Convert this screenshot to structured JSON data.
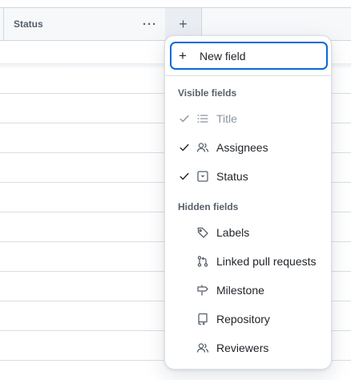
{
  "table": {
    "column": {
      "title": "Status",
      "menu_icon": "kebab-horizontal-icon"
    },
    "add_column_icon": "plus-icon"
  },
  "menu": {
    "new_field": {
      "label": "New field",
      "icon": "plus-icon"
    },
    "visible_section": "Visible fields",
    "hidden_section": "Hidden fields",
    "visible_items": [
      {
        "label": "Title",
        "icon": "list-icon",
        "checked": true,
        "disabled": true
      },
      {
        "label": "Assignees",
        "icon": "people-icon",
        "checked": true,
        "disabled": false
      },
      {
        "label": "Status",
        "icon": "single-select-icon",
        "checked": true,
        "disabled": false
      }
    ],
    "hidden_items": [
      {
        "label": "Labels",
        "icon": "tag-icon"
      },
      {
        "label": "Linked pull requests",
        "icon": "git-pull-request-icon"
      },
      {
        "label": "Milestone",
        "icon": "milestone-icon"
      },
      {
        "label": "Repository",
        "icon": "repo-icon"
      },
      {
        "label": "Reviewers",
        "icon": "people-icon"
      }
    ]
  },
  "colors": {
    "accent": "#0969da",
    "muted": "#57606a",
    "disabled": "#8c959f",
    "border": "#d0d7de"
  }
}
